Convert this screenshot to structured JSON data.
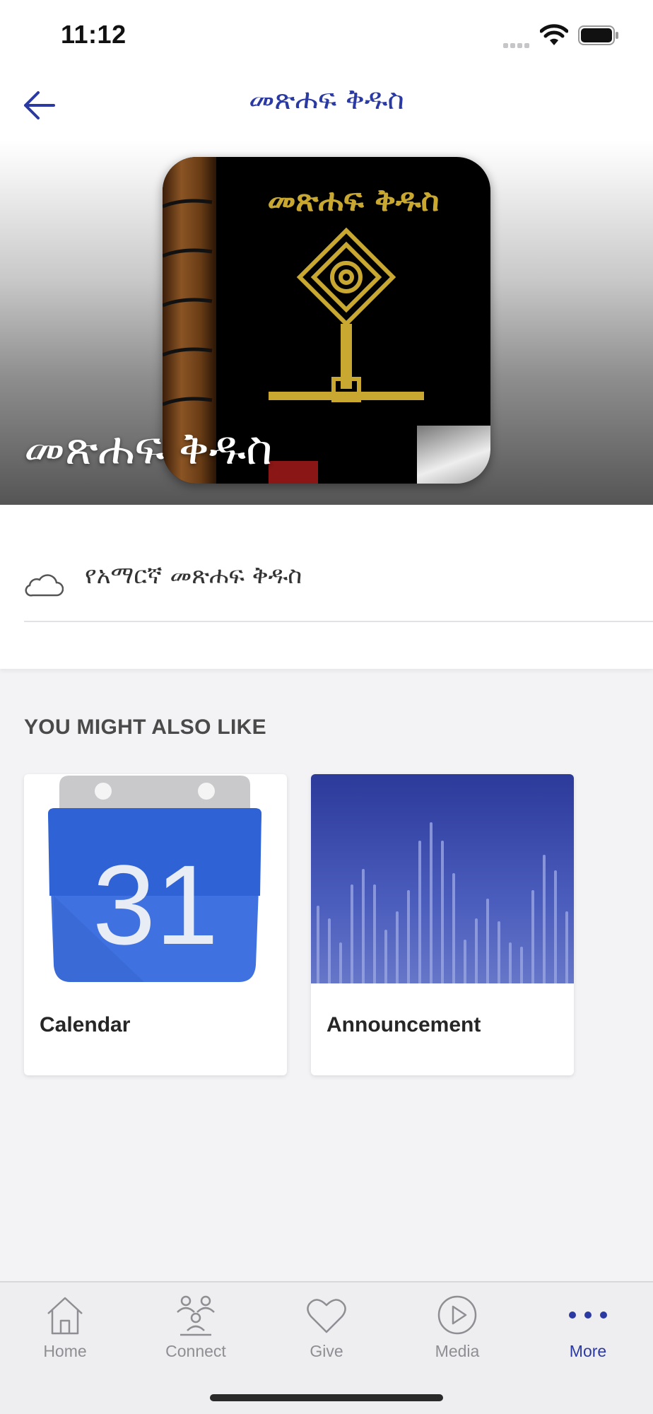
{
  "status_bar": {
    "time": "11:12"
  },
  "nav": {
    "title": "መጽሐፍ ቅዱስ",
    "back_icon": "arrow-left-icon"
  },
  "hero": {
    "book_cover_title": "መጽሐፍ ቅዱስ",
    "title": "መጽሐፍ ቅዱስ"
  },
  "list": {
    "items": [
      {
        "icon": "cloud-icon",
        "label": "የአማርኛ መጽሐፍ ቅዱስ"
      }
    ]
  },
  "recommendations": {
    "heading": "YOU MIGHT ALSO LIKE",
    "cards": [
      {
        "label": "Calendar",
        "image_number": "31",
        "icon": "calendar-icon"
      },
      {
        "label": "Announcement",
        "icon": "sound-wave-image"
      }
    ]
  },
  "tab_bar": {
    "active_color": "#2b3aa3",
    "inactive_color": "#8e8e93",
    "tabs": [
      {
        "label": "Home",
        "icon": "home-icon",
        "active": false
      },
      {
        "label": "Connect",
        "icon": "people-icon",
        "active": false
      },
      {
        "label": "Give",
        "icon": "heart-icon",
        "active": false
      },
      {
        "label": "Media",
        "icon": "play-icon",
        "active": false
      },
      {
        "label": "More",
        "icon": "more-dots-icon",
        "active": true
      }
    ]
  }
}
